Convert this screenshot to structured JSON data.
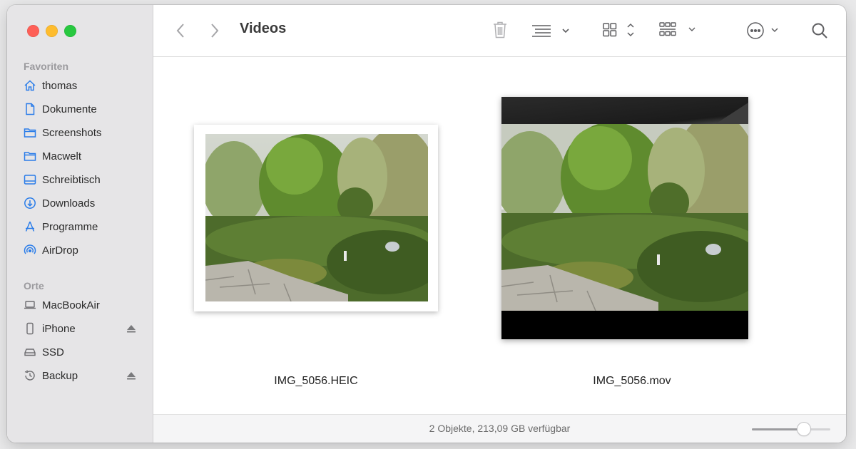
{
  "window": {
    "title": "Videos"
  },
  "sidebar": {
    "favorites_title": "Favoriten",
    "favorites": [
      {
        "label": "thomas",
        "icon": "house-icon"
      },
      {
        "label": "Dokumente",
        "icon": "document-icon"
      },
      {
        "label": "Screenshots",
        "icon": "folder-icon"
      },
      {
        "label": "Macwelt",
        "icon": "folder-icon"
      },
      {
        "label": "Schreibtisch",
        "icon": "desktop-icon"
      },
      {
        "label": "Downloads",
        "icon": "download-icon"
      },
      {
        "label": "Programme",
        "icon": "apps-icon"
      },
      {
        "label": "AirDrop",
        "icon": "airdrop-icon"
      }
    ],
    "places_title": "Orte",
    "places": [
      {
        "label": "MacBookAir",
        "icon": "laptop-icon"
      },
      {
        "label": "iPhone",
        "icon": "iphone-icon",
        "eject": true
      },
      {
        "label": "SSD",
        "icon": "drive-icon"
      },
      {
        "label": "Backup",
        "icon": "time-machine-icon",
        "eject": true
      }
    ]
  },
  "toolbar": {
    "title": "Videos",
    "icons": [
      "back-icon",
      "forward-icon",
      "trash-icon",
      "list-view-icon",
      "icon-view-icon",
      "group-icon",
      "more-icon",
      "search-icon"
    ]
  },
  "files": [
    {
      "name": "IMG_5056.HEIC"
    },
    {
      "name": "IMG_5056.mov"
    }
  ],
  "status": {
    "text": "2 Objekte, 213,09 GB verfügbar",
    "zoom_fraction": 0.7
  },
  "colors": {
    "accent": "#2b7de9",
    "sidebar_bg": "#e6e5e7"
  }
}
